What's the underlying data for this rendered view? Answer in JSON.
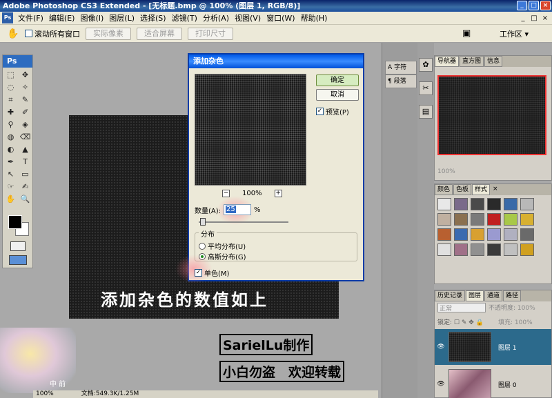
{
  "title": "Adobe Photoshop CS3 Extended - [无标题.bmp @ 100% (图层 1, RGB/8)]",
  "window_buttons": [
    "_",
    "□",
    "×"
  ],
  "menu": {
    "logo": "Ps",
    "items": [
      "文件(F)",
      "编辑(E)",
      "图像(I)",
      "图层(L)",
      "选择(S)",
      "滤镜(T)",
      "分析(A)",
      "视图(V)",
      "窗口(W)",
      "帮助(H)"
    ],
    "controls": [
      "_",
      "□",
      "×"
    ]
  },
  "options": {
    "scroll_all_label": "滚动所有窗口",
    "scroll_all_checked": false,
    "actual_pixels": "实际像素",
    "fit_screen": "适合屏幕",
    "print_size": "打印尺寸",
    "workspace": "工作区 ▾"
  },
  "tools": {
    "logo": "Ps",
    "items": [
      "⬚",
      "✥",
      "◌",
      "✧",
      "⌗",
      "✎",
      "✚",
      "✐",
      "⚲",
      "◈",
      "◍",
      "⌫",
      "◐",
      "▲",
      "✒",
      "T",
      "↖",
      "▭",
      "☞",
      "✍",
      "✋",
      "🔍"
    ]
  },
  "dialog": {
    "title": "添加杂色",
    "ok": "确定",
    "cancel": "取消",
    "preview_label": "预览(P)",
    "preview_checked": true,
    "zoom": "100%",
    "zoom_out": "−",
    "zoom_in": "+",
    "amount_label": "数量(A):",
    "amount_value": "25",
    "amount_unit": "%",
    "distribution_label": "分布",
    "uniform": "平均分布(U)",
    "gaussian": "高斯分布(G)",
    "gaussian_selected": true,
    "monochrome": "单色(M)",
    "monochrome_checked": true
  },
  "canvas": {
    "caption": "添加杂色的数值如上",
    "author": "SarielLu制作",
    "motto": "小白勿盗　欢迎转载"
  },
  "watermark": "中 前",
  "statusbar": {
    "zoom": "100%",
    "doc": "文档:549.3K/1.25M"
  },
  "dock": {
    "character": "字符",
    "paragraph": "段落"
  },
  "navigator": {
    "tabs": [
      "导航器",
      "直方图",
      "信息"
    ],
    "zoom": "100%"
  },
  "styles_panel": {
    "tabs": [
      "颜色",
      "色板",
      "样式"
    ],
    "swatches": [
      "#e8e8e8",
      "#7a6a8a",
      "#4a4a4a",
      "#2a2a2a",
      "#3a6aa8",
      "#b8b8b8",
      "#c0b0a0",
      "#8a7050",
      "#7a7a7a",
      "#c02020",
      "#a8c848",
      "#d8b030",
      "#b86030",
      "#3a6ab0",
      "#d8a030",
      "#9a9ad0",
      "#b0b0c0",
      "#6a6a6a",
      "#e0e0e0",
      "#a07088",
      "#909090",
      "#3a3a3a",
      "#c0c0c0",
      "#d0a020"
    ]
  },
  "layers_panel": {
    "tabs": [
      "历史记录",
      "图层",
      "通道",
      "路径"
    ],
    "mode": "正常",
    "opacity_label": "不透明度:",
    "opacity": "100%",
    "lock_label": "锁定:",
    "fill_label": "填充:",
    "fill": "100%",
    "layers": [
      {
        "name": "图层 1",
        "selected": true
      },
      {
        "name": "图层 0",
        "selected": false
      }
    ]
  }
}
